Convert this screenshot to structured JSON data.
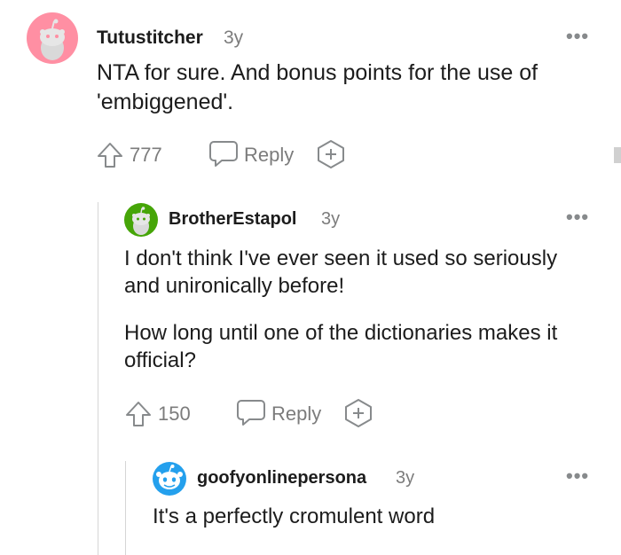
{
  "comments": [
    {
      "username": "Tutustitcher",
      "age": "3y",
      "body": [
        "NTA for sure. And bonus points for the use of 'embiggened'."
      ],
      "votes": "777",
      "reply_label": "Reply",
      "avatar_color": "#ff8fa3"
    },
    {
      "username": "BrotherEstapol",
      "age": "3y",
      "body": [
        "I don't think I've ever seen it used so seriously and unironically before!",
        "How long until one of the dictionaries makes it official?"
      ],
      "votes": "150",
      "reply_label": "Reply",
      "avatar_color": "#46a508"
    },
    {
      "username": "goofyonlinepersona",
      "age": "3y",
      "body": [
        "It's a perfectly cromulent word"
      ],
      "avatar_color": "#24a0ed"
    }
  ],
  "more_options": "•••",
  "icons": {
    "upvote": "upvote-arrow-icon",
    "reply": "speech-bubble-icon",
    "award": "award-plus-icon",
    "more": "more-options-icon",
    "avatar": "snoo-avatar-icon"
  }
}
